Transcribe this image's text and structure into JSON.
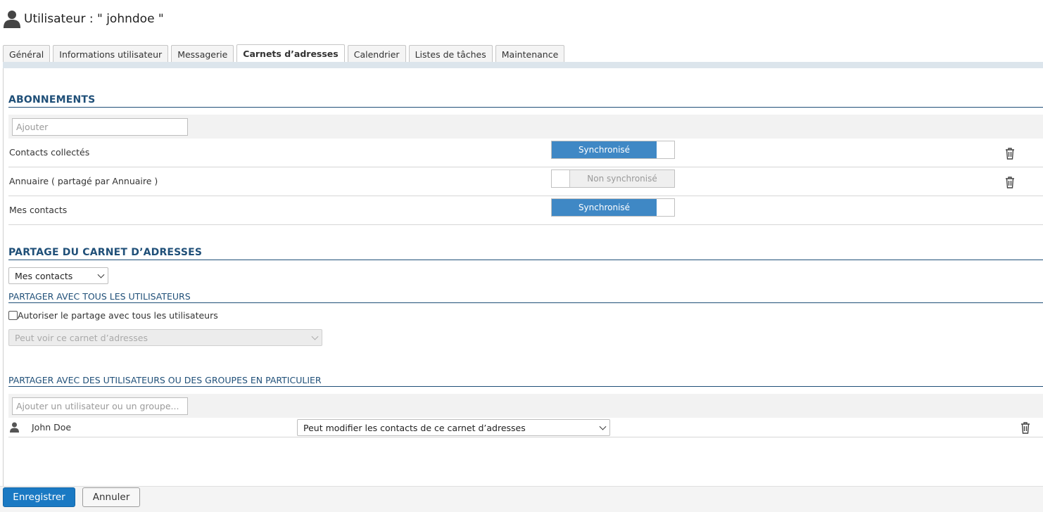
{
  "header": {
    "title": "Utilisateur : \" johndoe \""
  },
  "tabs": [
    {
      "label": "Général"
    },
    {
      "label": "Informations utilisateur"
    },
    {
      "label": "Messagerie"
    },
    {
      "label": "Carnets d’adresses",
      "active": true
    },
    {
      "label": "Calendrier"
    },
    {
      "label": "Listes de tâches"
    },
    {
      "label": "Maintenance"
    }
  ],
  "subscriptions": {
    "title": "ABONNEMENTS",
    "add_placeholder": "Ajouter",
    "items": [
      {
        "label": "Contacts collectés",
        "status": "Synchronisé",
        "synced": true
      },
      {
        "label": "Annuaire ( partagé par Annuaire )",
        "status": "Non synchronisé",
        "synced": false
      },
      {
        "label": "Mes contacts",
        "status": "Synchronisé",
        "synced": true
      }
    ]
  },
  "sharing": {
    "title": "PARTAGE DU CARNET D’ADRESSES",
    "book_select": "Mes contacts",
    "all_users": {
      "title": "PARTAGER AVEC TOUS LES UTILISATEURS",
      "checkbox_label": "Autoriser le partage avec tous les utilisateurs",
      "checked": false,
      "permission": "Peut voir ce carnet d’adresses"
    },
    "specific": {
      "title": "PARTAGER AVEC DES UTILISATEURS OU DES GROUPES EN PARTICULIER",
      "add_placeholder": "Ajouter un utilisateur ou un groupe...",
      "entries": [
        {
          "name": "John Doe",
          "permission": "Peut modifier les contacts de ce carnet d’adresses"
        }
      ]
    }
  },
  "footer": {
    "save_label": "Enregistrer",
    "cancel_label": "Annuler"
  },
  "colors": {
    "accent": "#1a79c3",
    "toggle_on": "#3f88c5",
    "section_title": "#1f4f78"
  }
}
